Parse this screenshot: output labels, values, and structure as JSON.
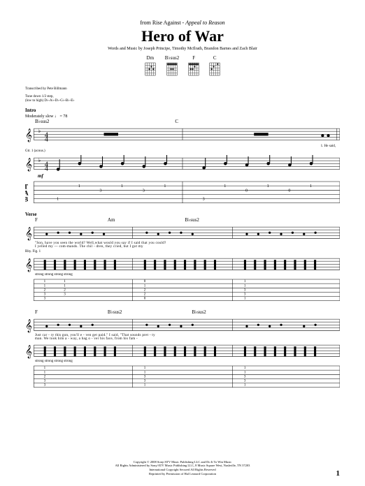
{
  "header": {
    "source_prefix": "from Rise Against - ",
    "album": "Appeal to Reason",
    "title": "Hero of War",
    "credits": "Words and Music by Joseph Principe, Timothy McIlrath, Brandon Barnes and Zach Blair",
    "transcriber": "Transcribed by Pete Billmann"
  },
  "chords": [
    {
      "name": "Dm"
    },
    {
      "name": "B♭sus2"
    },
    {
      "name": "F"
    },
    {
      "name": "C"
    }
  ],
  "tuning": {
    "line1": "Tune down 1/2 step,",
    "line2": "(low to high) D♭-A♭-D♭-G♭-B♭-E♭"
  },
  "intro": {
    "label": "Intro",
    "tempo": "Moderately slow ♩ = 78",
    "chord_a": "B♭sus2",
    "chord_b": "C",
    "gtr_note": "Gtr. 1 (acous.)",
    "dynamic": "mf",
    "end_lyric": "1. He said,"
  },
  "verse": {
    "label": "Verse",
    "chords_line1": [
      "F",
      "Am",
      "B♭sus2"
    ],
    "lyrics1a": "\"Son,    have  you   seen    the  world?        Well,what  would  you    say              if    I     said       that   you   could?",
    "lyrics1b": "      I   yelled   my    —   com-mands.           The  chil - dren,   they   cried,          but    I        got       my",
    "rhy_label": "Rhy. Fig. 1",
    "strum1": "strong        strong        strong        strong",
    "chords_line2": [
      "F",
      "B♭sus2",
      "B♭sus2"
    ],
    "lyrics2a": "     Just    car  -  ry   this   gun,          you'll    e  -  ven    get    paid.\"          I    said,  \"That    sounds     pret - ty",
    "lyrics2b": "man.    We  took   him  a - way,            a   bag   o - ver  his  face,                from  his  fam    -",
    "strum2": "strong        strong        strong        strong"
  },
  "footer": {
    "copyright": "Copyright © 2008 Sony/ATV Music Publishing LLC and Do It To Win Music\nAll Rights Administered by Sony/ATV Music Publishing LLC, 8 Music Square West, Nashville, TN 37203\nInternational Copyright Secured   All Rights Reserved\nReprinted by Permission of Hal Leonard Corporation",
    "page_number": "1"
  }
}
